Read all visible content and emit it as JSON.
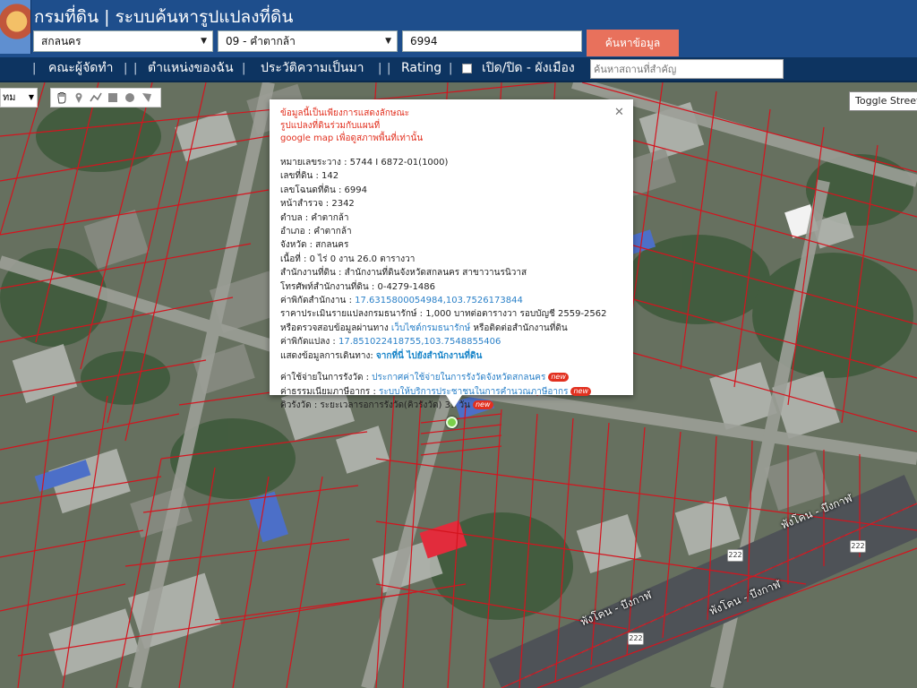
{
  "header": {
    "title": "กรมที่ดิน | ระบบค้นหารูปแปลงที่ดิน",
    "province_select": "สกลนคร",
    "district_select": "09 - คำตากล้า",
    "parcel_input": "6994",
    "search_button": "ค้นหาข้อมูล"
  },
  "nav": {
    "items": [
      "คณะผู้จัดทำ",
      "ตำแหน่งของฉัน",
      "ประวัติความเป็นมา",
      "Rating"
    ],
    "toggle_label": "เปิด/ปิด - ผังเมือง",
    "place_search_placeholder": "ค้นหาสถานที่สำคัญ"
  },
  "map_controls": {
    "map_type": "ทม",
    "toggle_street_view": "Toggle Street View",
    "tools": [
      "hand-icon",
      "pin-icon",
      "polyline-icon",
      "rectangle-icon",
      "circle-icon",
      "polygon-icon"
    ]
  },
  "info": {
    "notice": [
      "ข้อมูลนี้เป็นเพียงการแสดงลักษณะ",
      "รูปแปลงที่ดินร่วมกับแผนที่",
      "google map เพื่อดูสภาพพื้นที่เท่านั้น"
    ],
    "rows": [
      {
        "label": "หมายเลขระวาง : ",
        "value": "5744 I 6872-01(1000)"
      },
      {
        "label": "เลขที่ดิน : ",
        "value": "142"
      },
      {
        "label": "เลขโฉนดที่ดิน : ",
        "value": "6994"
      },
      {
        "label": "หน้าสำรวจ : ",
        "value": "2342"
      },
      {
        "label": "ตำบล : ",
        "value": "คำตากล้า"
      },
      {
        "label": "อำเภอ : ",
        "value": "คำตากล้า"
      },
      {
        "label": "จังหวัด : ",
        "value": "สกลนคร"
      },
      {
        "label": "เนื้อที่ : ",
        "value": "0 ไร่ 0 งาน 26.0 ตารางวา"
      },
      {
        "label": "สำนักงานที่ดิน : ",
        "value": "สำนักงานที่ดินจังหวัดสกลนคร สาขาวานรนิวาส"
      },
      {
        "label": "โทรศัพท์สำนักงานที่ดิน : ",
        "value": "0-4279-1486"
      }
    ],
    "office_coord_label": "ค่าพิกัดสำนักงาน : ",
    "office_coord": "17.6315800054984,103.7526173844",
    "price_text": "ราคาประเมินรายแปลงกรมธนารักษ์ : 1,000 บาทต่อตารางวา รอบบัญชี 2559-2562",
    "check_prefix": "หรือตรวจสอบข้อมูลผ่านทาง ",
    "check_link": "เว็บไซต์กรมธนารักษ์",
    "check_suffix": " หรือติดต่อสำนักงานที่ดิน",
    "parcel_coord_label": "ค่าพิกัดแปลง : ",
    "parcel_coord": "17.851022418755,103.7548855406",
    "route_label": "แสดงข้อมูลการเดินทาง: ",
    "route_link": "จากที่นี่ ไปยังสำนักงานที่ดิน",
    "fee_label": "ค่าใช้จ่ายในการรังวัด : ",
    "fee_link": "ประกาศค่าใช้จ่ายในการรังวัดจังหวัดสกลนคร",
    "tax_label": "ค่าธรรมเนียมภาษีอากร : ",
    "tax_link": "ระบบให้บริการประชาชนในการคำนวณภาษีอากร",
    "queue_label": "คิวรังวัด : ",
    "queue_value": "ระยะเวลารอการรังวัด(คิวรังวัด) 31 วัน",
    "new_badge": "new"
  },
  "map_labels": {
    "road_1": "พังโคน - บึงกาฬ",
    "road_2": "พังโคน - บึงกาฬ",
    "road_3": "พังโคน - บึงกาฬ",
    "shield": "222"
  },
  "colors": {
    "header_bg": "#1e4e8c",
    "nav_bg": "#0d3461",
    "search_button": "#e8715c",
    "parcel_lines": "#d4141e",
    "notice_red": "#e2301f",
    "link_blue": "#2a80c8"
  }
}
